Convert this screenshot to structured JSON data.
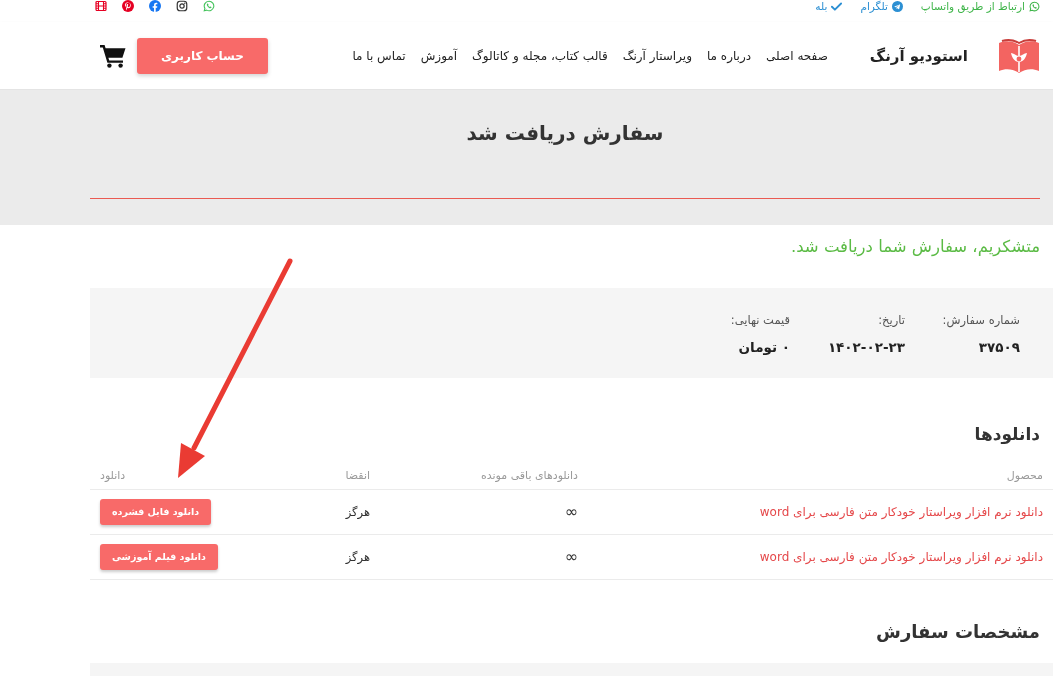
{
  "top_bar": {
    "contacts": [
      {
        "kind": "whatsapp",
        "label": "ارتباط از طریق واتساپ"
      },
      {
        "kind": "telegram",
        "label": "تلگرام"
      },
      {
        "kind": "check",
        "label": "بله"
      }
    ]
  },
  "header": {
    "logo_text": "استودیو آرنگ",
    "nav": [
      "صفحه اصلی",
      "درباره ما",
      "ویراستار آرنگ",
      "قالب کتاب، مجله و کاتالوگ",
      "آموزش",
      "تماس با ما"
    ],
    "account_button": "حساب کاربری"
  },
  "page_title": "سفارش دریافت شد",
  "thank_you": "متشکریم، سفارش شما دریافت شد.",
  "order_overview": [
    {
      "label": "شماره سفارش:",
      "value": "۳۷۵۰۹"
    },
    {
      "label": "تاریخ:",
      "value": "۱۴۰۲-۰۲-۲۳"
    },
    {
      "label": "قیمت نهایی:",
      "value": "۰ تومان"
    }
  ],
  "downloads": {
    "title": "دانلودها",
    "columns": [
      "محصول",
      "دانلودهای باقی مونده",
      "انقضا",
      "دانلود"
    ],
    "rows": [
      {
        "product": "دانلود نرم افزار ویراستار خودکار متن فارسی برای word",
        "remaining": "∞",
        "expires": "هرگز",
        "button": "دانلود فایل فشرده"
      },
      {
        "product": "دانلود نرم افزار ویراستار خودکار متن فارسی برای word",
        "remaining": "∞",
        "expires": "هرگز",
        "button": "دانلود فیلم آموزشی"
      }
    ]
  },
  "order_details": {
    "title": "مشخصات سفارش"
  }
}
